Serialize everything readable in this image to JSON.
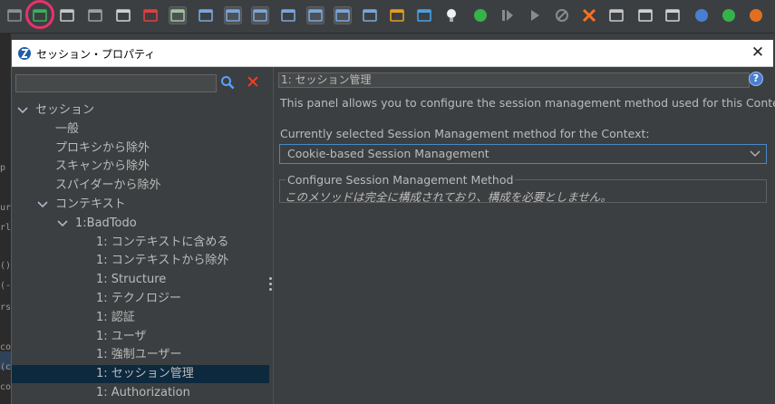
{
  "window": {
    "title": "セッション・プロパティ",
    "close_glyph": "✕"
  },
  "toolbar": {
    "icons": [
      "screen-icon",
      "session-properties-icon",
      "options-gear-icon",
      "layout-icon",
      "desktop-icon",
      "desktop-remove-icon",
      "desktop-panel-icon",
      "panel-left-icon",
      "panel-bottom-icon",
      "panel-full-icon",
      "tab-icon-1",
      "tab-icon-2",
      "tab-icon-3",
      "tab-icon-4",
      "marketplace-icon",
      "scan-icon",
      "lightbulb-icon",
      "break-icon",
      "step-icon",
      "continue-icon",
      "drop-icon",
      "clear-breakpoints-icon",
      "keyboard-icon",
      "manage-users-icon",
      "hud-icon",
      "help-icon",
      "globe-icon",
      "firefox-icon"
    ]
  },
  "left": {
    "search": {
      "value": "",
      "placeholder": ""
    },
    "tree": [
      {
        "label": "セッション",
        "indent": 0,
        "arrow": "v"
      },
      {
        "label": "一般",
        "indent": 1
      },
      {
        "label": "プロキシから除外",
        "indent": 1
      },
      {
        "label": "スキャンから除外",
        "indent": 1
      },
      {
        "label": "スパイダーから除外",
        "indent": 1
      },
      {
        "label": "コンテキスト",
        "indent": 1,
        "arrow": "v"
      },
      {
        "label": "1:BadTodo",
        "indent": 2,
        "arrow": "v"
      },
      {
        "label": "1: コンテキストに含める",
        "indent": 3
      },
      {
        "label": "1: コンテキストから除外",
        "indent": 3
      },
      {
        "label": "1: Structure",
        "indent": 3
      },
      {
        "label": "1: テクノロジー",
        "indent": 3
      },
      {
        "label": "1: 認証",
        "indent": 3
      },
      {
        "label": "1: ユーザ",
        "indent": 3
      },
      {
        "label": "1: 強制ユーザー",
        "indent": 3
      },
      {
        "label": "1: セッション管理",
        "indent": 3,
        "selected": true
      },
      {
        "label": "1: Authorization",
        "indent": 3
      }
    ]
  },
  "right": {
    "header": "1: セッション管理",
    "help_glyph": "?",
    "description": "This panel allows you to configure the session management method used for this Context.",
    "method_label": "Currently selected Session Management method for the Context:",
    "method_value": "Cookie-based Session Management",
    "configure_legend": "Configure Session Management Method",
    "configure_info": "このメソッドは完全に構成されており、構成を必要としません。"
  },
  "background_fragments": [
    "p",
    "ur",
    "rl",
    "()",
    "(-",
    "rs",
    "co",
    "(c",
    "co"
  ],
  "colors": {
    "accent_ring": "#e6336b",
    "selection": "#0d293e",
    "focus_border": "#4a88c7",
    "clear_red": "#ff3b1e"
  }
}
